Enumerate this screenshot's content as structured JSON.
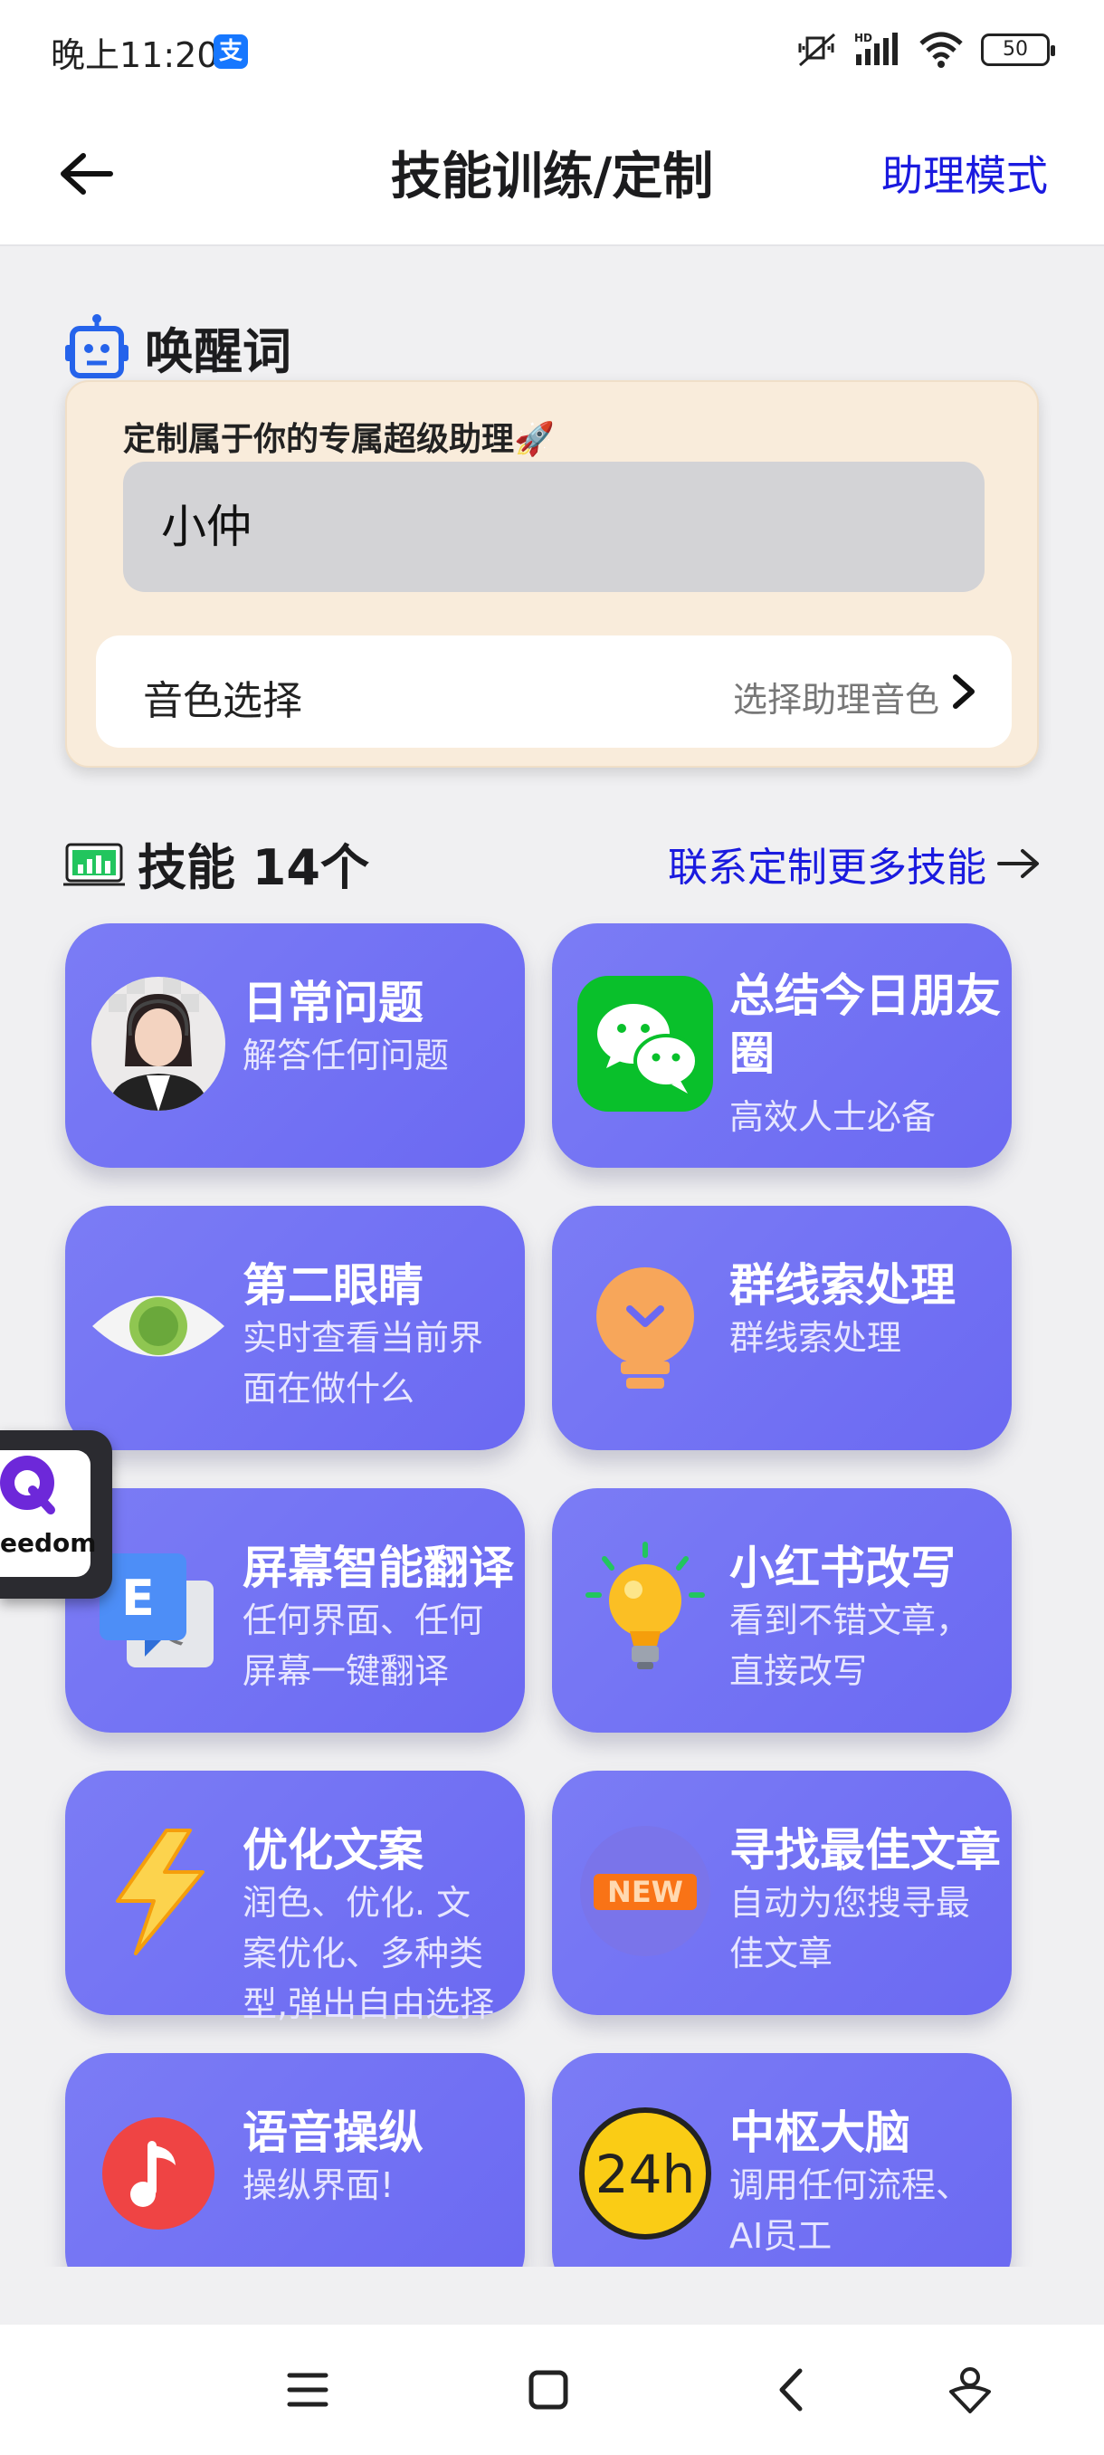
{
  "status_bar": {
    "time": "晚上11:20",
    "app_badge": "支",
    "battery": "50"
  },
  "header": {
    "title": "技能训练/定制",
    "assistant_mode": "助理模式"
  },
  "wake": {
    "section_title": "唤醒词",
    "subtitle": "定制属于你的专属超级助理🚀",
    "value": "小仲",
    "voice_label": "音色选择",
    "voice_value": "选择助理音色"
  },
  "skills": {
    "title": "技能 14个",
    "contact_link": "联系定制更多技能",
    "items": [
      {
        "name": "日常问题",
        "desc": "解答任何问题",
        "icon": "avatar-icon"
      },
      {
        "name": "总结今日朋友圈",
        "desc": "高效人士必备",
        "icon": "wechat-icon"
      },
      {
        "name": "第二眼睛",
        "desc": "实时查看当前界面在做什么",
        "icon": "eye-icon"
      },
      {
        "name": "群线索处理",
        "desc": "群线索处理",
        "icon": "lightbulb-badge-icon"
      },
      {
        "name": "屏幕智能翻译",
        "desc": "任何界面、任何屏幕一键翻译",
        "icon": "translate-icon"
      },
      {
        "name": "小红书改写",
        "desc": "看到不错文章，直接改写",
        "icon": "bulb-icon"
      },
      {
        "name": "优化文案",
        "desc": "润色、优化. 文案优化、多种类型,弹出自由选择",
        "icon": "lightning-icon"
      },
      {
        "name": "寻找最佳文章",
        "desc": "自动为您搜寻最佳文章",
        "icon": "new-badge-icon",
        "badge": "NEW"
      },
      {
        "name": "语音操纵",
        "desc": "操纵界面!",
        "icon": "music-note-icon"
      },
      {
        "name": "中枢大脑",
        "desc": "调用任何流程、AI员工",
        "icon": "clock-24h-icon",
        "badge": "24h"
      }
    ]
  },
  "floating": {
    "label": "eedom"
  },
  "colors": {
    "accent_link": "#1a1adf",
    "card_gradient": "#7b7cf5",
    "wake_card_bg": "#f9ecdb"
  }
}
